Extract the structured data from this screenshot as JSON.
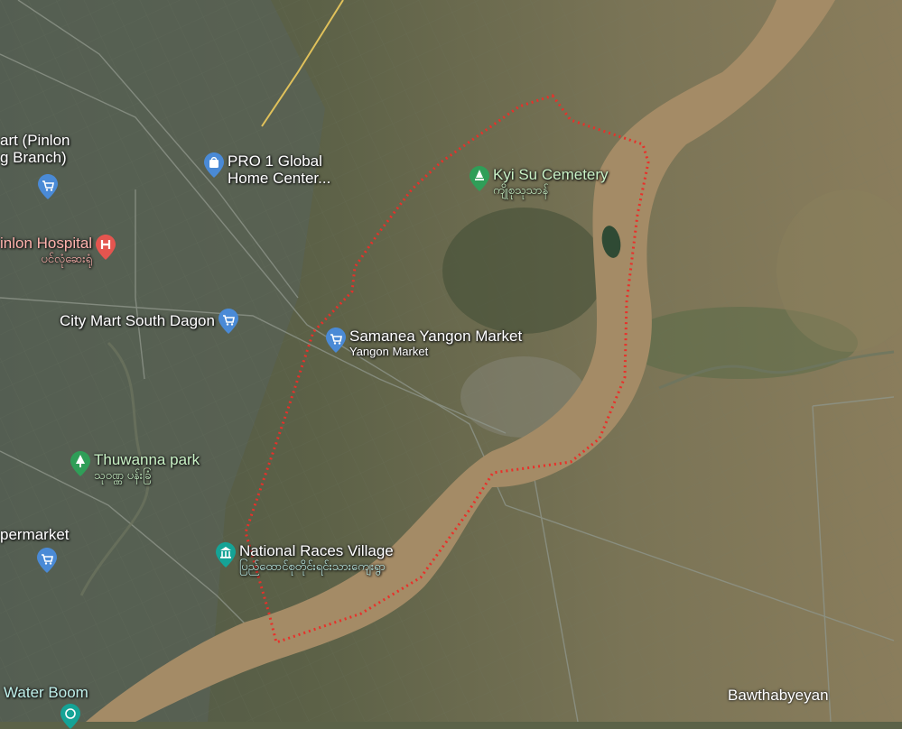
{
  "map": {
    "colors": {
      "river": "#a48b66",
      "land_dark": "#4f5a43",
      "land_light": "#7c7356",
      "boundary": "#e8302a",
      "shopping_pin": "#4a8ad6",
      "hospital_pin": "#e4554f",
      "park_pin": "#2f9e58",
      "attraction_pin": "#15a396"
    },
    "labels": {
      "pinlon_branch_line1": "art (Pinlon",
      "pinlon_branch_line2": "g Branch)",
      "pro1": "PRO 1 Global",
      "pro1_line2": "Home Center...",
      "pinlon_hospital": "inlon Hospital",
      "pinlon_hospital_my": "ပင်လုံဆေးရုံ",
      "city_mart": "City Mart South Dagon",
      "samanea": "Samanea Yangon Market",
      "samanea_sub": "Yangon Market",
      "kyi_su": "Kyi Su Cemetery",
      "kyi_su_my": "ကျိုစုသုသာန်",
      "thuwanna": "Thuwanna park",
      "thuwanna_my": "သုဝဏ္ဏ ပန်းခြံ",
      "supermarket": "permarket",
      "national_races": "National Races Village",
      "national_races_my": "ပြည်ထောင်စုတိုင်းရင်းသားကျေးရွာ",
      "water_boom": "Water Boom",
      "bawthabyeyan": "Bawthabyeyan"
    },
    "icons": [
      "shopping-cart-icon",
      "shopping-bag-icon",
      "hospital-icon",
      "cemetery-icon",
      "park-tree-icon",
      "museum-icon"
    ]
  }
}
